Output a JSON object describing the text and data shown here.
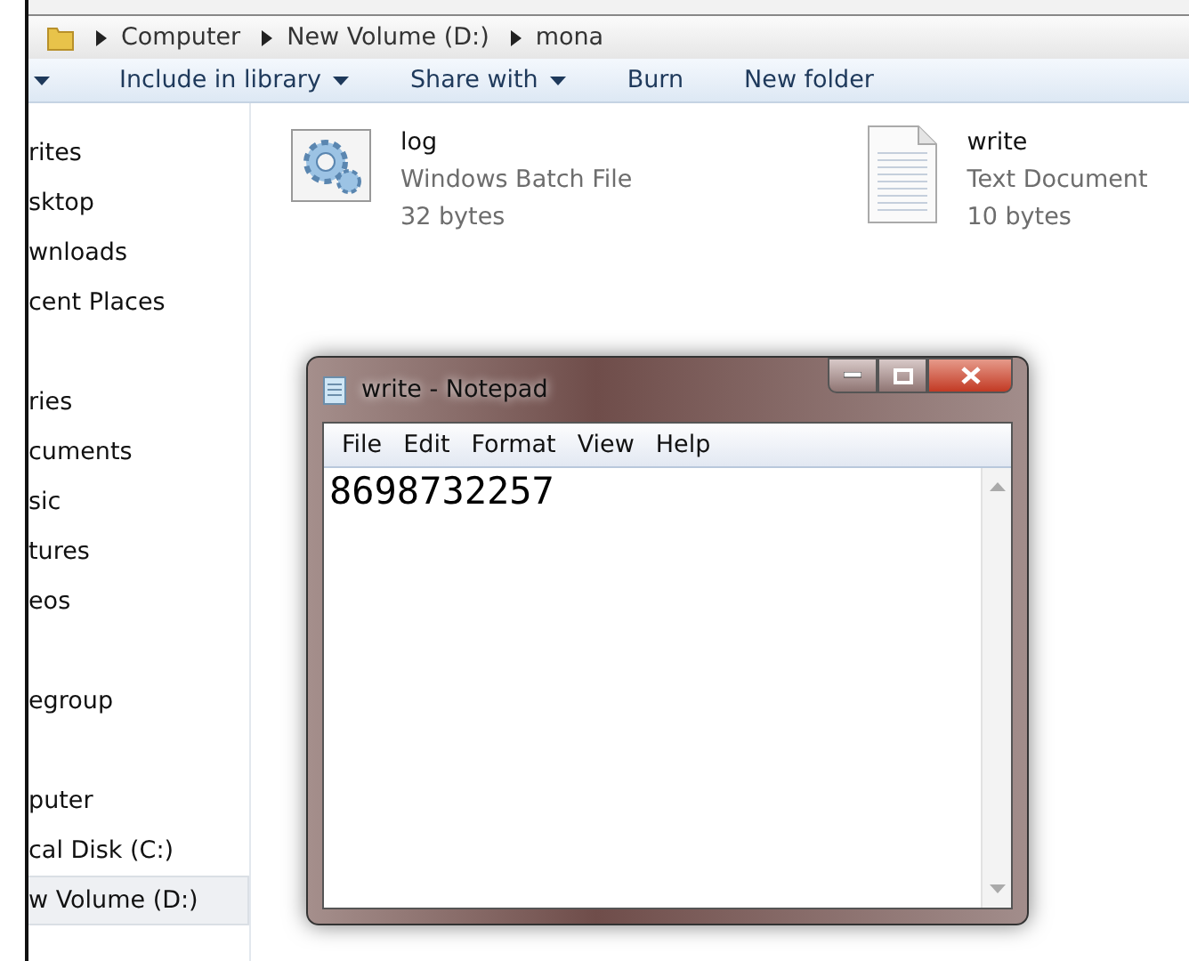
{
  "address_bar": {
    "crumbs": [
      "Computer",
      "New Volume (D:)",
      "mona"
    ]
  },
  "toolbar": [
    {
      "has_menu": true
    },
    {
      "label": "Include in library",
      "has_menu": true
    },
    {
      "label": "Share with",
      "has_menu": true
    },
    {
      "label": "Burn",
      "has_menu": false
    },
    {
      "label": "New folder",
      "has_menu": false
    }
  ],
  "sidebar": {
    "groups": [
      {
        "items": [
          {
            "label": "rites",
            "selected": false
          },
          {
            "label": "sktop",
            "selected": false
          },
          {
            "label": "wnloads",
            "selected": false
          },
          {
            "label": "cent Places",
            "selected": false
          }
        ]
      },
      {
        "items": [
          {
            "label": "ries",
            "selected": false
          },
          {
            "label": "cuments",
            "selected": false
          },
          {
            "label": "sic",
            "selected": false
          },
          {
            "label": "tures",
            "selected": false
          },
          {
            "label": "eos",
            "selected": false
          }
        ]
      },
      {
        "items": [
          {
            "label": "egroup",
            "selected": false
          }
        ]
      },
      {
        "items": [
          {
            "label": "puter",
            "selected": false
          },
          {
            "label": "cal Disk (C:)",
            "selected": false
          },
          {
            "label": "w Volume (D:)",
            "selected": true
          }
        ]
      }
    ]
  },
  "files": [
    {
      "kind": "batch",
      "name": "log",
      "type": "Windows Batch File",
      "size": "32 bytes"
    },
    {
      "kind": "text",
      "name": "write",
      "type": "Text Document",
      "size": "10 bytes"
    }
  ],
  "notepad": {
    "title": "write - Notepad",
    "menu": [
      "File",
      "Edit",
      "Format",
      "View",
      "Help"
    ],
    "content": "8698732257"
  }
}
